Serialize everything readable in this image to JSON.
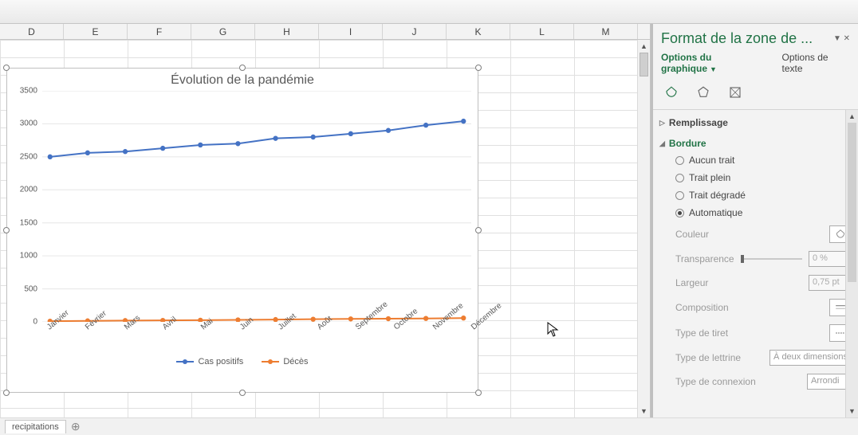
{
  "columns": [
    "D",
    "E",
    "F",
    "G",
    "H",
    "I",
    "J",
    "K",
    "L",
    "M"
  ],
  "sheet_tab": "recipitations",
  "chart_data": {
    "type": "line",
    "title": "Évolution de la pandémie",
    "categories": [
      "Janvier",
      "Février",
      "Mars",
      "Avril",
      "Mai",
      "Juin",
      "Juillet",
      "Août",
      "Septembre",
      "Octobre",
      "Novembre",
      "Décembre"
    ],
    "series": [
      {
        "name": "Cas positifs",
        "values": [
          2500,
          2560,
          2580,
          2630,
          2680,
          2700,
          2780,
          2800,
          2850,
          2900,
          2980,
          3040
        ],
        "color": "#4472C4"
      },
      {
        "name": "Décès",
        "values": [
          10,
          15,
          20,
          22,
          25,
          30,
          35,
          40,
          45,
          48,
          52,
          58
        ],
        "color": "#ED7D31"
      }
    ],
    "ylim": [
      0,
      3500
    ],
    "ystep": 500,
    "xlabel": "",
    "ylabel": ""
  },
  "format_pane": {
    "title": "Format de la zone de ...",
    "sub_active": "Options du graphique",
    "sub_inactive": "Options de texte",
    "sections": {
      "fill": {
        "label": "Remplissage",
        "expanded": false
      },
      "border": {
        "label": "Bordure",
        "expanded": true,
        "options": {
          "none": "Aucun trait",
          "solid": "Trait plein",
          "grad": "Trait dégradé",
          "auto": "Automatique"
        },
        "selected": "auto",
        "color_label": "Couleur",
        "transparency_label": "Transparence",
        "transparency_value": "0 %",
        "width_label": "Largeur",
        "width_value": "0,75 pt",
        "compound_label": "Composition",
        "dash_label": "Type de tiret",
        "cap_label": "Type de lettrine",
        "cap_value": "À deux dimensions",
        "join_label": "Type de connexion",
        "join_value": "Arrondi"
      }
    }
  }
}
